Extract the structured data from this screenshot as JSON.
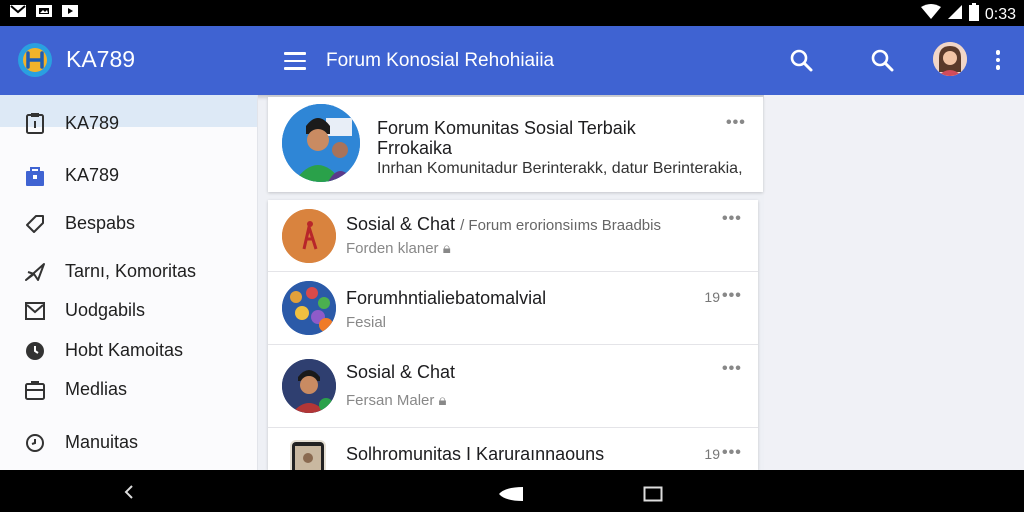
{
  "status_bar": {
    "time": "0:33"
  },
  "app_bar": {
    "app_name": "KA789",
    "forum_title": "Forum Konosial Rehohiaiia"
  },
  "sidebar": {
    "items": [
      {
        "label": "KA789",
        "icon": "clipboard-icon"
      },
      {
        "label": "KA789",
        "icon": "bag-icon"
      },
      {
        "label": "Bespabs",
        "icon": "tag-icon"
      },
      {
        "label": "Tarnı, Komoritas",
        "icon": "send-icon"
      },
      {
        "label": "Uodgabils",
        "icon": "mail-icon"
      },
      {
        "label": "Hobt Kamoitas",
        "icon": "clock-icon"
      },
      {
        "label": "Medlias",
        "icon": "inbox-icon"
      },
      {
        "label": "Manuitas",
        "icon": "history-icon"
      }
    ]
  },
  "hero": {
    "line1": "Forum Komunitas Sosial Terbaik",
    "line2": "Frrokaika",
    "line3": "Inrhan Komunitadur Berinterakk, datur Berinterakia,"
  },
  "threads": [
    {
      "title": "Sosial & Chat",
      "subtitle": "/ Forum erorionsiıms Braadbis",
      "meta": "Forden klaner",
      "time": ""
    },
    {
      "title": "Forumhntialiebatomalvial",
      "subtitle": "",
      "meta": "Fesial",
      "time": "19"
    },
    {
      "title": "Sosial & Chat",
      "subtitle": "",
      "meta": "Fersan Maler",
      "time": ""
    },
    {
      "title": "Solhromunitas I Karuraınnaouns",
      "subtitle": "",
      "meta": "",
      "time": "19"
    }
  ],
  "colors": {
    "app_bar": "#3f63d2",
    "selected_nav": "#dde9f6",
    "accent_blue": "#3f63d2"
  }
}
